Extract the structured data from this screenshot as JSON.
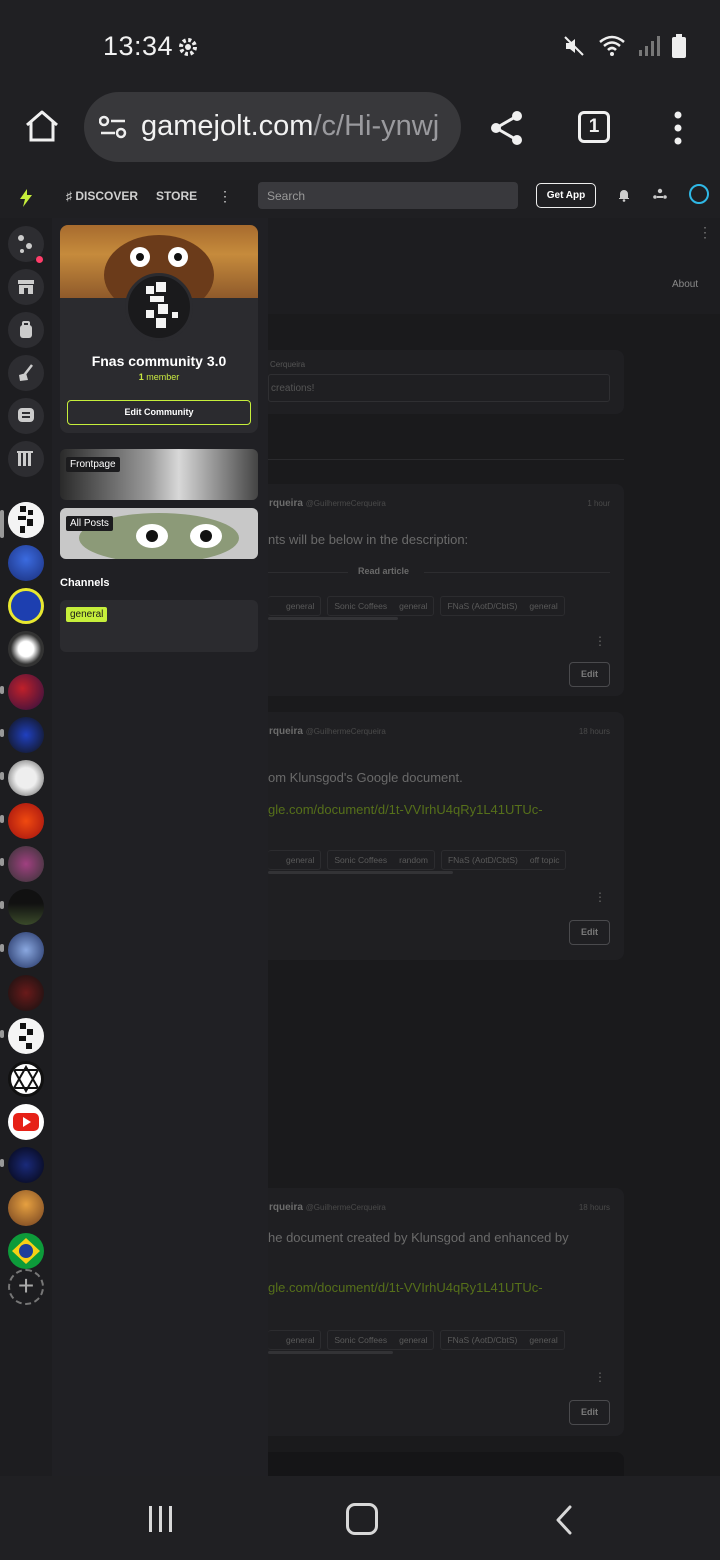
{
  "status": {
    "time": "13:34"
  },
  "browser": {
    "url_host": "gamejolt.com",
    "url_path": "/c/Hi-ynwj",
    "tab_count": "1"
  },
  "header": {
    "discover_label": "DISCOVER",
    "store_label": "STORE",
    "search_placeholder": "Search",
    "get_app_label": "Get App"
  },
  "community": {
    "name": "Fnas community 3.0",
    "member_count": "1",
    "member_label": "member",
    "edit_button": "Edit Community",
    "nav_cards": [
      "Frontpage",
      "All Posts"
    ],
    "channels_heading": "Channels",
    "channels": [
      "general"
    ]
  },
  "main": {
    "about_label": "About",
    "composer_author": "Cerqueira",
    "composer_placeholder": "creations!",
    "posts": [
      {
        "author": "rqueira",
        "handle": "@GuilhermeCerqueira",
        "time": "1 hour",
        "text": "nts will be below in the description:",
        "read_article": "Read article",
        "tags": [
          {
            "community": "",
            "channel": "general"
          },
          {
            "community": "Sonic Coffees",
            "channel": "general"
          },
          {
            "community": "FNaS (AotD/CbtS)",
            "channel": "general"
          }
        ],
        "edit_label": "Edit"
      },
      {
        "author": "rqueira",
        "handle": "@GuilhermeCerqueira",
        "time": "18 hours",
        "text": "om Klunsgod's Google document.",
        "link": "gle.com/document/d/1t-VVIrhU4qRy1L41UTUc-",
        "tags": [
          {
            "community": "",
            "channel": "general"
          },
          {
            "community": "Sonic Coffees",
            "channel": "random"
          },
          {
            "community": "FNaS (AotD/CbtS)",
            "channel": "off topic"
          }
        ],
        "edit_label": "Edit"
      },
      {
        "author": "rqueira",
        "handle": "@GuilhermeCerqueira",
        "time": "18 hours",
        "text": "he document created by Klunsgod and enhanced by",
        "link": "gle.com/document/d/1t-VVIrhU4qRy1L41UTUc-",
        "tags": [
          {
            "community": "",
            "channel": "general"
          },
          {
            "community": "Sonic Coffees",
            "channel": "general"
          },
          {
            "community": "FNaS (AotD/CbtS)",
            "channel": "general"
          }
        ],
        "edit_label": "Edit"
      }
    ]
  },
  "colors": {
    "accent": "#c6ef3b",
    "notification": "#ff3d6a",
    "ring": "#2fb8e6"
  }
}
